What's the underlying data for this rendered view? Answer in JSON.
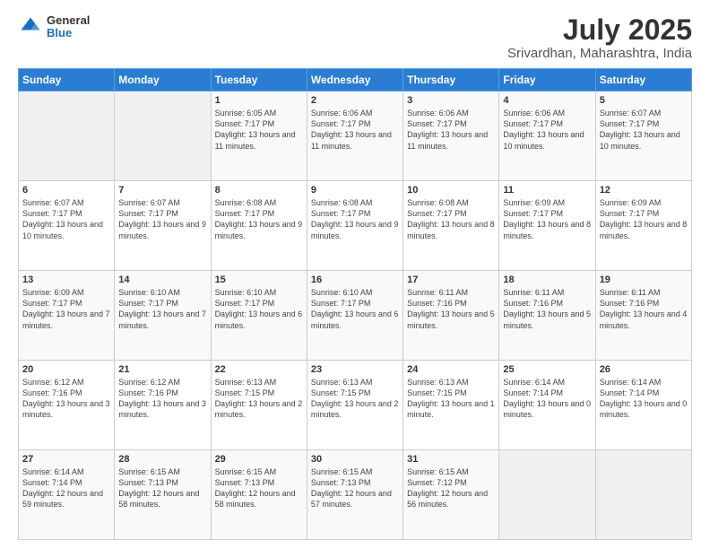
{
  "header": {
    "logo": {
      "general": "General",
      "blue": "Blue"
    },
    "title": "July 2025",
    "subtitle": "Srivardhan, Maharashtra, India"
  },
  "weekdays": [
    "Sunday",
    "Monday",
    "Tuesday",
    "Wednesday",
    "Thursday",
    "Friday",
    "Saturday"
  ],
  "weeks": [
    [
      {
        "num": "",
        "info": ""
      },
      {
        "num": "",
        "info": ""
      },
      {
        "num": "1",
        "info": "Sunrise: 6:05 AM\nSunset: 7:17 PM\nDaylight: 13 hours and 11 minutes."
      },
      {
        "num": "2",
        "info": "Sunrise: 6:06 AM\nSunset: 7:17 PM\nDaylight: 13 hours and 11 minutes."
      },
      {
        "num": "3",
        "info": "Sunrise: 6:06 AM\nSunset: 7:17 PM\nDaylight: 13 hours and 11 minutes."
      },
      {
        "num": "4",
        "info": "Sunrise: 6:06 AM\nSunset: 7:17 PM\nDaylight: 13 hours and 10 minutes."
      },
      {
        "num": "5",
        "info": "Sunrise: 6:07 AM\nSunset: 7:17 PM\nDaylight: 13 hours and 10 minutes."
      }
    ],
    [
      {
        "num": "6",
        "info": "Sunrise: 6:07 AM\nSunset: 7:17 PM\nDaylight: 13 hours and 10 minutes."
      },
      {
        "num": "7",
        "info": "Sunrise: 6:07 AM\nSunset: 7:17 PM\nDaylight: 13 hours and 9 minutes."
      },
      {
        "num": "8",
        "info": "Sunrise: 6:08 AM\nSunset: 7:17 PM\nDaylight: 13 hours and 9 minutes."
      },
      {
        "num": "9",
        "info": "Sunrise: 6:08 AM\nSunset: 7:17 PM\nDaylight: 13 hours and 9 minutes."
      },
      {
        "num": "10",
        "info": "Sunrise: 6:08 AM\nSunset: 7:17 PM\nDaylight: 13 hours and 8 minutes."
      },
      {
        "num": "11",
        "info": "Sunrise: 6:09 AM\nSunset: 7:17 PM\nDaylight: 13 hours and 8 minutes."
      },
      {
        "num": "12",
        "info": "Sunrise: 6:09 AM\nSunset: 7:17 PM\nDaylight: 13 hours and 8 minutes."
      }
    ],
    [
      {
        "num": "13",
        "info": "Sunrise: 6:09 AM\nSunset: 7:17 PM\nDaylight: 13 hours and 7 minutes."
      },
      {
        "num": "14",
        "info": "Sunrise: 6:10 AM\nSunset: 7:17 PM\nDaylight: 13 hours and 7 minutes."
      },
      {
        "num": "15",
        "info": "Sunrise: 6:10 AM\nSunset: 7:17 PM\nDaylight: 13 hours and 6 minutes."
      },
      {
        "num": "16",
        "info": "Sunrise: 6:10 AM\nSunset: 7:17 PM\nDaylight: 13 hours and 6 minutes."
      },
      {
        "num": "17",
        "info": "Sunrise: 6:11 AM\nSunset: 7:16 PM\nDaylight: 13 hours and 5 minutes."
      },
      {
        "num": "18",
        "info": "Sunrise: 6:11 AM\nSunset: 7:16 PM\nDaylight: 13 hours and 5 minutes."
      },
      {
        "num": "19",
        "info": "Sunrise: 6:11 AM\nSunset: 7:16 PM\nDaylight: 13 hours and 4 minutes."
      }
    ],
    [
      {
        "num": "20",
        "info": "Sunrise: 6:12 AM\nSunset: 7:16 PM\nDaylight: 13 hours and 3 minutes."
      },
      {
        "num": "21",
        "info": "Sunrise: 6:12 AM\nSunset: 7:16 PM\nDaylight: 13 hours and 3 minutes."
      },
      {
        "num": "22",
        "info": "Sunrise: 6:13 AM\nSunset: 7:15 PM\nDaylight: 13 hours and 2 minutes."
      },
      {
        "num": "23",
        "info": "Sunrise: 6:13 AM\nSunset: 7:15 PM\nDaylight: 13 hours and 2 minutes."
      },
      {
        "num": "24",
        "info": "Sunrise: 6:13 AM\nSunset: 7:15 PM\nDaylight: 13 hours and 1 minute."
      },
      {
        "num": "25",
        "info": "Sunrise: 6:14 AM\nSunset: 7:14 PM\nDaylight: 13 hours and 0 minutes."
      },
      {
        "num": "26",
        "info": "Sunrise: 6:14 AM\nSunset: 7:14 PM\nDaylight: 13 hours and 0 minutes."
      }
    ],
    [
      {
        "num": "27",
        "info": "Sunrise: 6:14 AM\nSunset: 7:14 PM\nDaylight: 12 hours and 59 minutes."
      },
      {
        "num": "28",
        "info": "Sunrise: 6:15 AM\nSunset: 7:13 PM\nDaylight: 12 hours and 58 minutes."
      },
      {
        "num": "29",
        "info": "Sunrise: 6:15 AM\nSunset: 7:13 PM\nDaylight: 12 hours and 58 minutes."
      },
      {
        "num": "30",
        "info": "Sunrise: 6:15 AM\nSunset: 7:13 PM\nDaylight: 12 hours and 57 minutes."
      },
      {
        "num": "31",
        "info": "Sunrise: 6:15 AM\nSunset: 7:12 PM\nDaylight: 12 hours and 56 minutes."
      },
      {
        "num": "",
        "info": ""
      },
      {
        "num": "",
        "info": ""
      }
    ]
  ]
}
